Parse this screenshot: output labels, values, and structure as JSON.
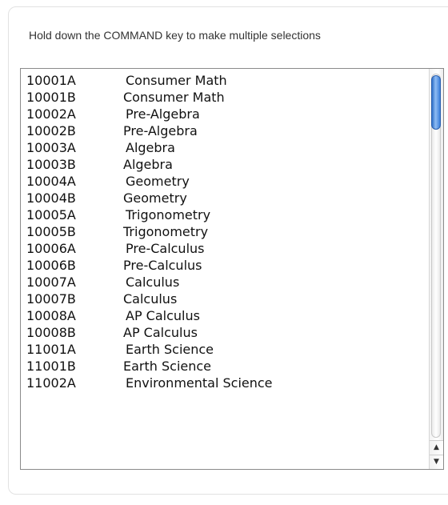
{
  "instruction": "Hold down the COMMAND key to make multiple selections",
  "options": [
    {
      "code": "10001A",
      "course": "Consumer Math"
    },
    {
      "code": "10001B",
      "course": "Consumer Math"
    },
    {
      "code": "10002A",
      "course": "Pre-Algebra"
    },
    {
      "code": "10002B",
      "course": "Pre-Algebra"
    },
    {
      "code": "10003A",
      "course": "Algebra"
    },
    {
      "code": "10003B",
      "course": "Algebra"
    },
    {
      "code": "10004A",
      "course": "Geometry"
    },
    {
      "code": "10004B",
      "course": "Geometry"
    },
    {
      "code": "10005A",
      "course": "Trigonometry"
    },
    {
      "code": "10005B",
      "course": "Trigonometry"
    },
    {
      "code": "10006A",
      "course": "Pre-Calculus"
    },
    {
      "code": "10006B",
      "course": "Pre-Calculus"
    },
    {
      "code": "10007A",
      "course": "Calculus"
    },
    {
      "code": "10007B",
      "course": "Calculus"
    },
    {
      "code": "10008A",
      "course": "AP Calculus"
    },
    {
      "code": "10008B",
      "course": "AP Calculus"
    },
    {
      "code": "11001A",
      "course": "Earth Science"
    },
    {
      "code": "11001B",
      "course": "Earth Science"
    },
    {
      "code": "11002A",
      "course": "Environmental Science"
    }
  ],
  "scrollbar": {
    "up_icon": "triangle-up",
    "down_icon": "triangle-down",
    "thumb_color": "#3d80dc"
  }
}
